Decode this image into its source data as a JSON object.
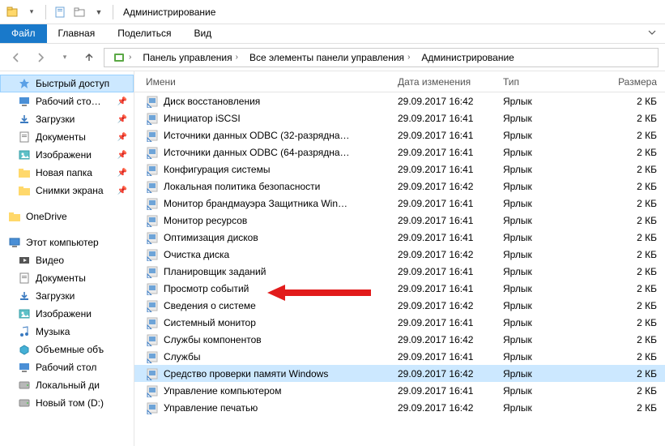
{
  "window": {
    "title": "Администрирование"
  },
  "ribbon": {
    "file": "Файл",
    "tabs": [
      "Главная",
      "Поделиться",
      "Вид"
    ]
  },
  "breadcrumb": {
    "items": [
      "Панель управления",
      "Все элементы панели управления",
      "Администрирование"
    ]
  },
  "sidebar": {
    "quick_access": {
      "label": "Быстрый доступ"
    },
    "pinned": [
      {
        "label": "Рабочий сто…",
        "icon": "desktop"
      },
      {
        "label": "Загрузки",
        "icon": "downloads"
      },
      {
        "label": "Документы",
        "icon": "documents"
      },
      {
        "label": "Изображени",
        "icon": "pictures"
      },
      {
        "label": "Новая папка",
        "icon": "folder"
      },
      {
        "label": "Снимки экрана",
        "icon": "folder"
      }
    ],
    "onedrive": {
      "label": "OneDrive"
    },
    "this_pc": {
      "label": "Этот компьютер"
    },
    "pc_items": [
      {
        "label": "Видео",
        "icon": "video"
      },
      {
        "label": "Документы",
        "icon": "documents"
      },
      {
        "label": "Загрузки",
        "icon": "downloads"
      },
      {
        "label": "Изображени",
        "icon": "pictures"
      },
      {
        "label": "Музыка",
        "icon": "music"
      },
      {
        "label": "Объемные объ",
        "icon": "3d"
      },
      {
        "label": "Рабочий стол",
        "icon": "desktop"
      },
      {
        "label": "Локальный ди",
        "icon": "drive"
      },
      {
        "label": "Новый том (D:)",
        "icon": "drive"
      }
    ]
  },
  "columns": {
    "name": "Имени",
    "date": "Дата изменения",
    "type": "Тип",
    "size": "Размера"
  },
  "files": [
    {
      "name": "Диск восстановления",
      "date": "29.09.2017 16:42",
      "type": "Ярлык",
      "size": "2 КБ"
    },
    {
      "name": "Инициатор iSCSI",
      "date": "29.09.2017 16:41",
      "type": "Ярлык",
      "size": "2 КБ"
    },
    {
      "name": "Источники данных ODBC (32-разрядна…",
      "date": "29.09.2017 16:41",
      "type": "Ярлык",
      "size": "2 КБ"
    },
    {
      "name": "Источники данных ODBC (64-разрядна…",
      "date": "29.09.2017 16:41",
      "type": "Ярлык",
      "size": "2 КБ"
    },
    {
      "name": "Конфигурация системы",
      "date": "29.09.2017 16:41",
      "type": "Ярлык",
      "size": "2 КБ"
    },
    {
      "name": "Локальная политика безопасности",
      "date": "29.09.2017 16:42",
      "type": "Ярлык",
      "size": "2 КБ"
    },
    {
      "name": "Монитор брандмауэра Защитника Win…",
      "date": "29.09.2017 16:41",
      "type": "Ярлык",
      "size": "2 КБ"
    },
    {
      "name": "Монитор ресурсов",
      "date": "29.09.2017 16:41",
      "type": "Ярлык",
      "size": "2 КБ"
    },
    {
      "name": "Оптимизация дисков",
      "date": "29.09.2017 16:41",
      "type": "Ярлык",
      "size": "2 КБ"
    },
    {
      "name": "Очистка диска",
      "date": "29.09.2017 16:42",
      "type": "Ярлык",
      "size": "2 КБ"
    },
    {
      "name": "Планировщик заданий",
      "date": "29.09.2017 16:41",
      "type": "Ярлык",
      "size": "2 КБ"
    },
    {
      "name": "Просмотр событий",
      "date": "29.09.2017 16:41",
      "type": "Ярлык",
      "size": "2 КБ"
    },
    {
      "name": "Сведения о системе",
      "date": "29.09.2017 16:42",
      "type": "Ярлык",
      "size": "2 КБ"
    },
    {
      "name": "Системный монитор",
      "date": "29.09.2017 16:41",
      "type": "Ярлык",
      "size": "2 КБ"
    },
    {
      "name": "Службы компонентов",
      "date": "29.09.2017 16:42",
      "type": "Ярлык",
      "size": "2 КБ"
    },
    {
      "name": "Службы",
      "date": "29.09.2017 16:41",
      "type": "Ярлык",
      "size": "2 КБ"
    },
    {
      "name": "Средство проверки памяти Windows",
      "date": "29.09.2017 16:42",
      "type": "Ярлык",
      "size": "2 КБ",
      "highlighted": true
    },
    {
      "name": "Управление компьютером",
      "date": "29.09.2017 16:41",
      "type": "Ярлык",
      "size": "2 КБ"
    },
    {
      "name": "Управление печатью",
      "date": "29.09.2017 16:42",
      "type": "Ярлык",
      "size": "2 КБ"
    }
  ],
  "arrow": {
    "target_index": 11
  }
}
